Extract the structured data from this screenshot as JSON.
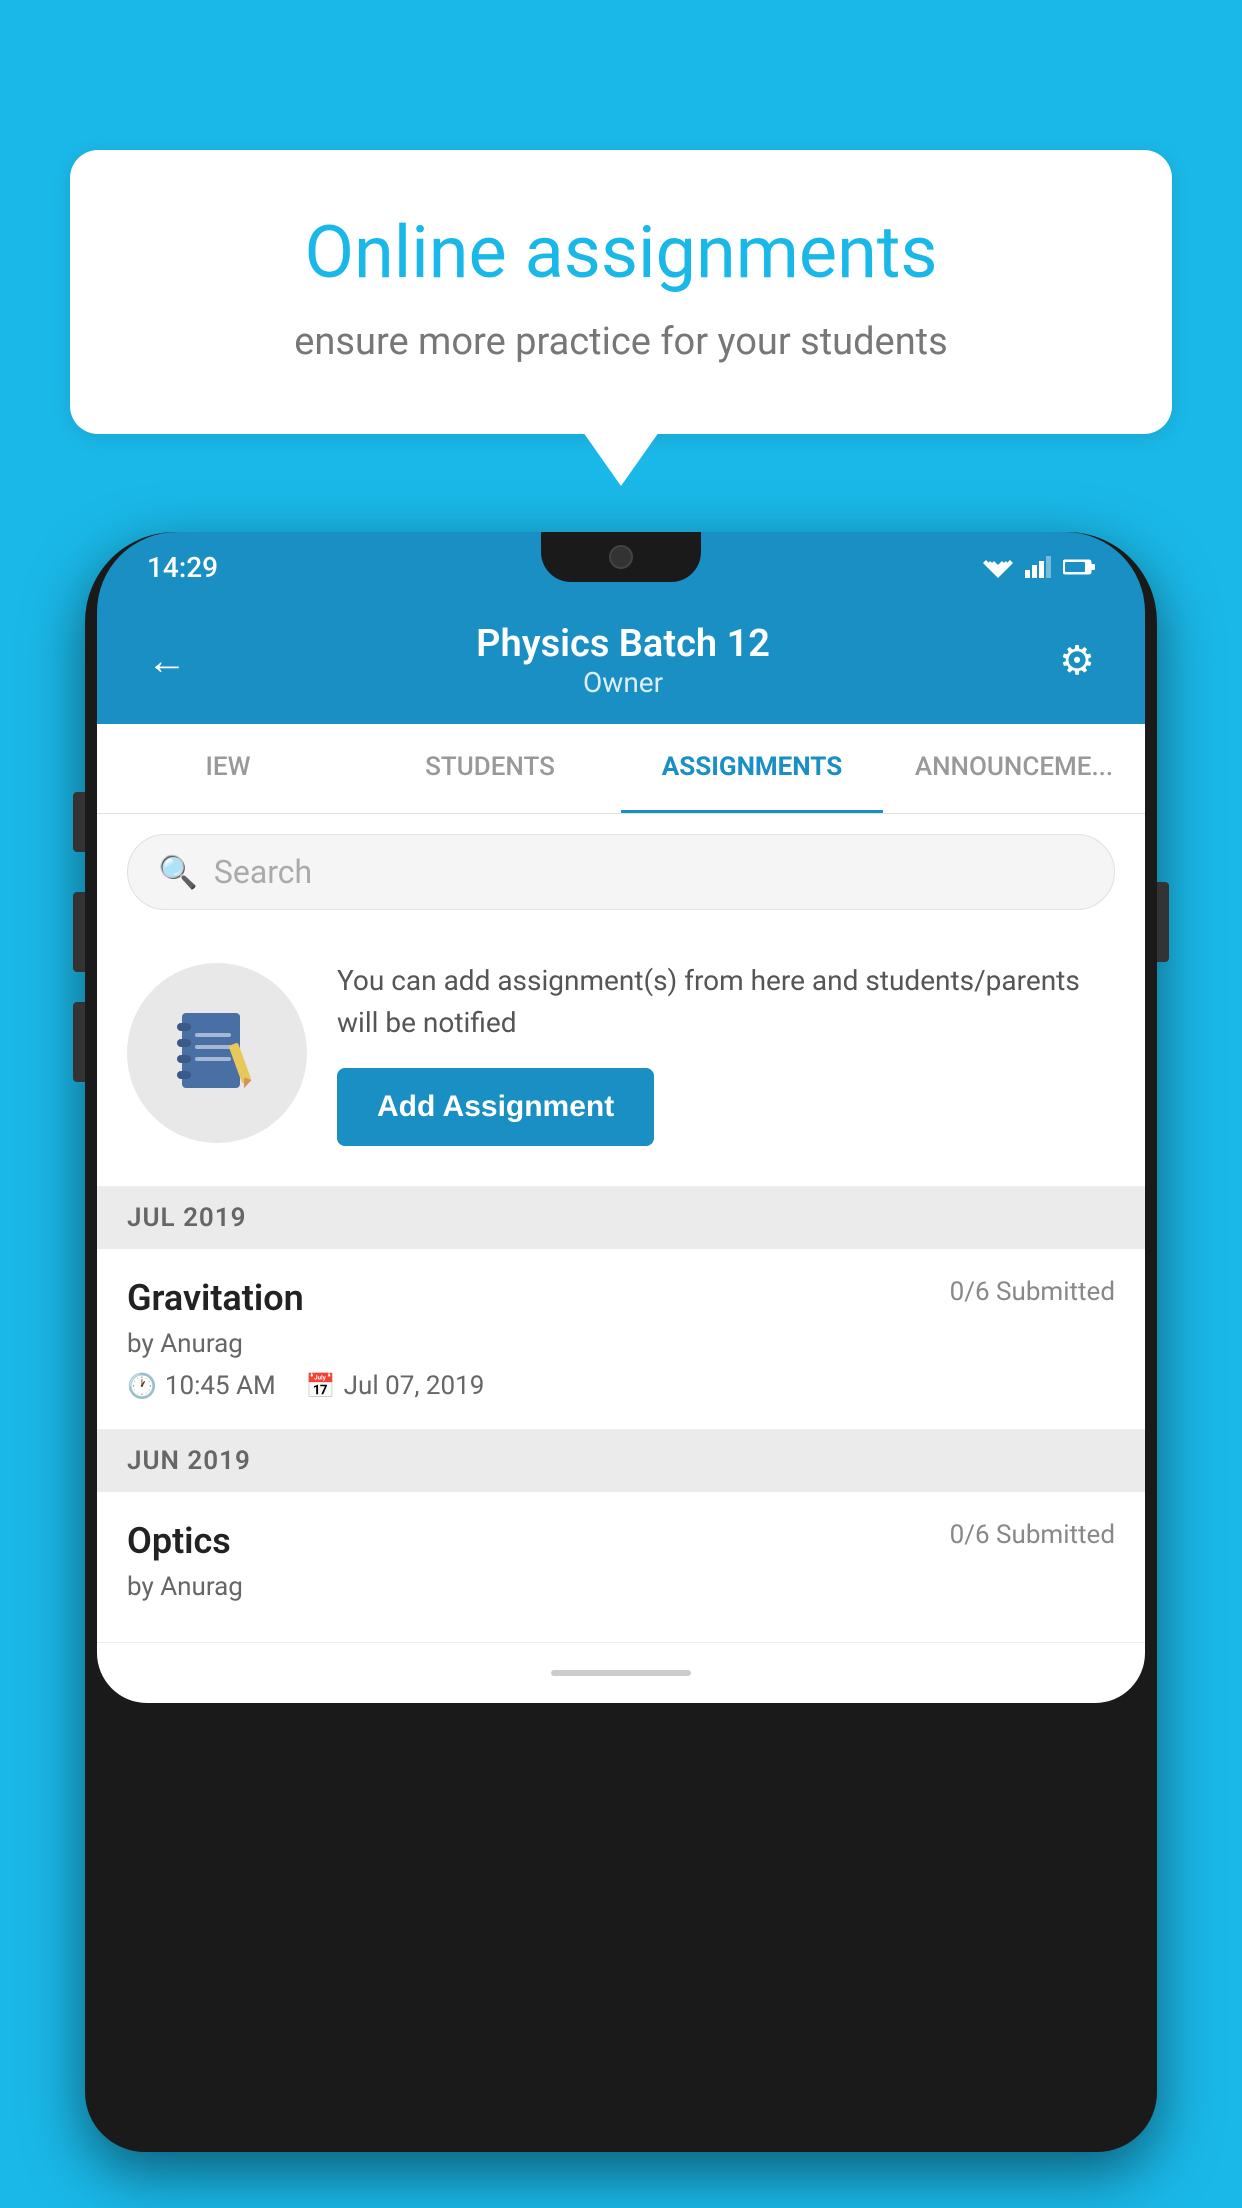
{
  "background_color": "#1ab8e8",
  "speech_bubble": {
    "title": "Online assignments",
    "subtitle": "ensure more practice for your students"
  },
  "phone": {
    "status_bar": {
      "time": "14:29"
    },
    "header": {
      "title": "Physics Batch 12",
      "subtitle": "Owner",
      "back_label": "←",
      "gear_label": "⚙"
    },
    "tabs": [
      {
        "label": "IEW",
        "active": false
      },
      {
        "label": "STUDENTS",
        "active": false
      },
      {
        "label": "ASSIGNMENTS",
        "active": true
      },
      {
        "label": "ANNOUNCEMENTS",
        "active": false
      }
    ],
    "search": {
      "placeholder": "Search"
    },
    "promo": {
      "description": "You can add assignment(s) from here and students/parents will be notified",
      "button_label": "Add Assignment"
    },
    "sections": [
      {
        "month": "JUL 2019",
        "assignments": [
          {
            "name": "Gravitation",
            "submitted": "0/6 Submitted",
            "author": "by Anurag",
            "time": "10:45 AM",
            "date": "Jul 07, 2019"
          }
        ]
      },
      {
        "month": "JUN 2019",
        "assignments": [
          {
            "name": "Optics",
            "submitted": "0/6 Submitted",
            "author": "by Anurag",
            "time": "",
            "date": ""
          }
        ]
      }
    ]
  }
}
